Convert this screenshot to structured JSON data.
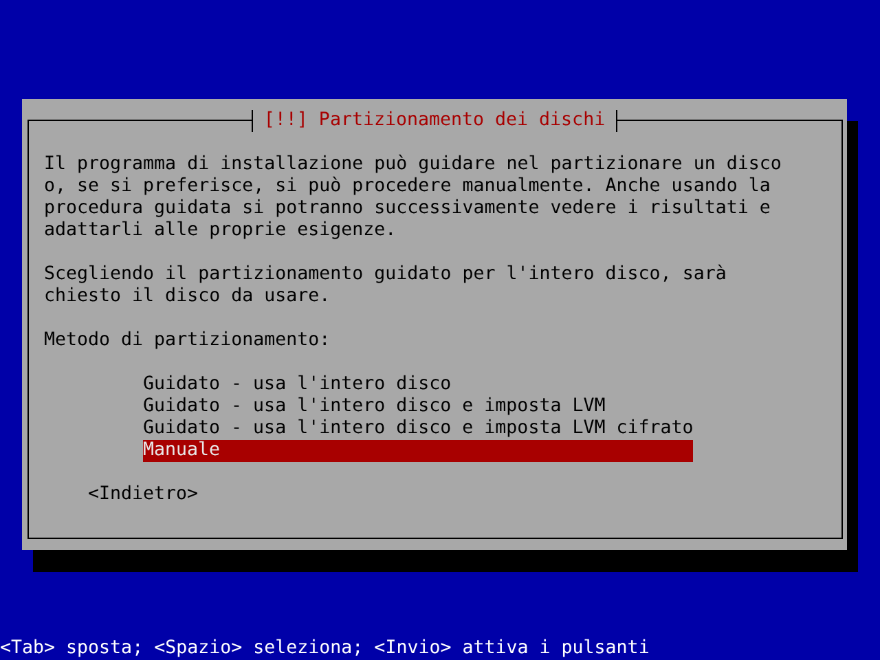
{
  "dialog": {
    "title": "[!!] Partizionamento dei dischi",
    "paragraphs": [
      [
        "Il programma di installazione può guidare nel partizionare un disco",
        "o, se si preferisce, si può procedere manualmente. Anche usando la",
        "procedura guidata si potranno successivamente vedere i risultati e",
        "adattarli alle proprie esigenze."
      ],
      [
        "Scegliendo il partizionamento guidato per l'intero disco, sarà",
        "chiesto il disco da usare."
      ]
    ],
    "prompt": "Metodo di partizionamento:",
    "options": [
      {
        "label": "Guidato - usa l'intero disco",
        "selected": false
      },
      {
        "label": "Guidato - usa l'intero disco e imposta LVM",
        "selected": false
      },
      {
        "label": "Guidato - usa l'intero disco e imposta LVM cifrato",
        "selected": false
      },
      {
        "label": "Manuale",
        "selected": true
      }
    ],
    "back_button": "<Indietro>"
  },
  "status_bar": "<Tab> sposta; <Spazio> seleziona; <Invio> attiva i pulsanti"
}
